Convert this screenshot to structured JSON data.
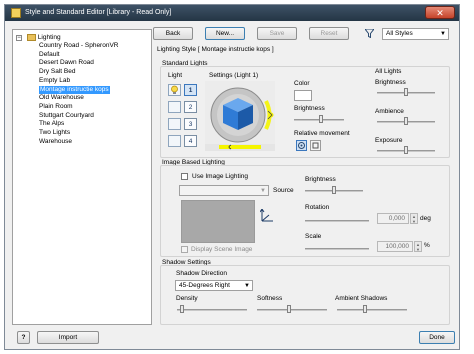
{
  "window": {
    "title": "Style and Standard Editor [Library - Read Only]",
    "close_symbol": "✕"
  },
  "tree": {
    "expander_symbol": "−",
    "root": "Lighting",
    "items": [
      "Country Road - SpheronVR",
      "Default",
      "Desert Dawn Road",
      "Dry Salt Bed",
      "Empty Lab",
      "Montage instructie kops",
      "Old Warehouse",
      "Plain Room",
      "Stuttgart Courtyard",
      "The Alps",
      "Two Lights",
      "Warehouse"
    ],
    "selected_index": 5
  },
  "toolbar": {
    "back": "Back",
    "new": "New...",
    "save": "Save",
    "reset": "Reset",
    "filter_value": "All Styles"
  },
  "style_header": "Lighting Style [ Montage instructie kops ]",
  "standard_lights": {
    "group_title": "Standard Lights",
    "light_label": "Light",
    "settings_label": "Settings (Light 1)",
    "light_numbers": [
      "1",
      "2",
      "3",
      "4"
    ],
    "active_light": "1",
    "color_label": "Color",
    "brightness_label": "Brightness",
    "relative_movement_label": "Relative movement",
    "all_lights_title": "All Lights",
    "all_brightness_label": "Brightness",
    "ambience_label": "Ambience",
    "exposure_label": "Exposure",
    "brightness_level": 0.55,
    "all_brightness_level": 0.5,
    "ambience_level": 0.5,
    "exposure_level": 0.5
  },
  "ibl": {
    "group_title": "Image Based Lighting",
    "use_image_lighting": "Use Image Lighting",
    "source_label": "Source",
    "display_scene_image": "Display Scene Image",
    "brightness_label": "Brightness",
    "rotation_label": "Rotation",
    "rotation_value": "0,000",
    "rotation_unit": "deg",
    "scale_label": "Scale",
    "scale_value": "100,000",
    "scale_unit": "%",
    "brightness_level": 0.5
  },
  "shadow": {
    "group_title": "Shadow Settings",
    "direction_label": "Shadow Direction",
    "direction_value": "45-Degrees Right",
    "density_label": "Density",
    "softness_label": "Softness",
    "ambient_shadows_label": "Ambient Shadows",
    "density_level": 0.05,
    "softness_level": 0.45,
    "ambient_level": 0.4
  },
  "footer": {
    "help_symbol": "?",
    "import": "Import",
    "done": "Done"
  },
  "colors": {
    "titlebar": "#2f4356",
    "selection": "#3399ff",
    "highlight": "#f5f500",
    "cube": "#2f7bd6"
  }
}
